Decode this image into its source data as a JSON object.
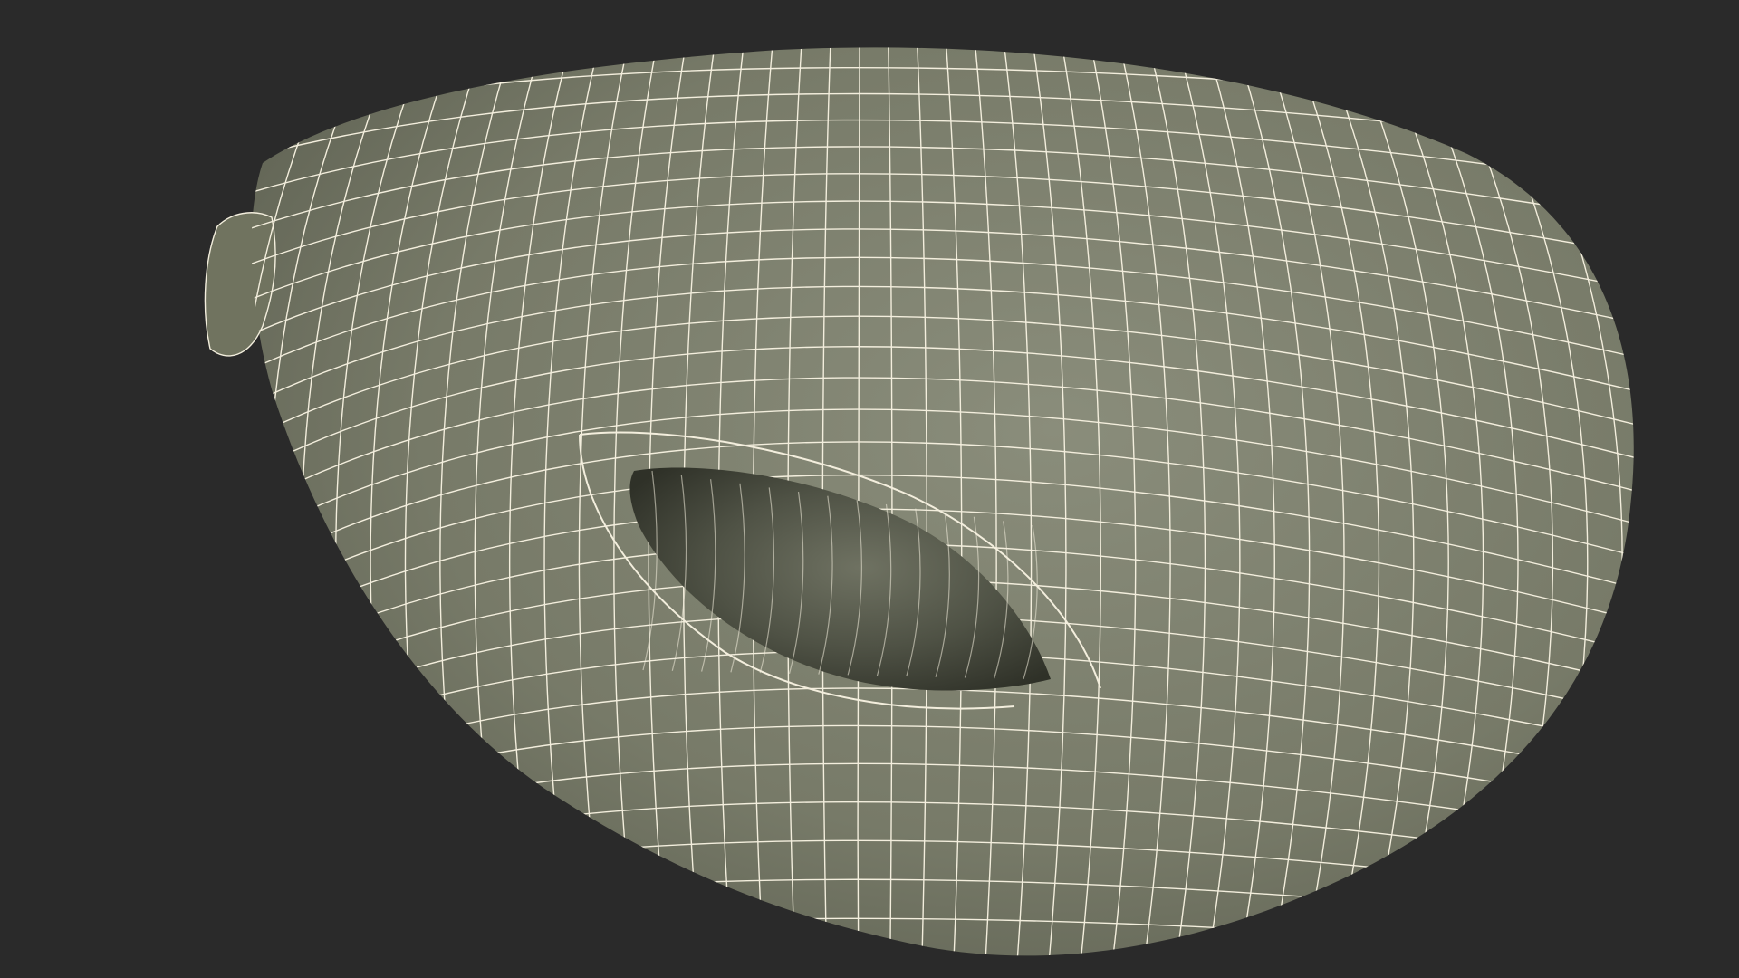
{
  "viewport": {
    "background_color": "#2a2a2a",
    "object": {
      "kind": "3d wireframe mesh",
      "shape": "rounded shell with a recessed eye-shaped opening",
      "surface_color": "#777a68",
      "surface_shadow_color": "#4c4f43",
      "wire_color": "#f3eedd",
      "wire_pattern": "quad grid"
    }
  }
}
